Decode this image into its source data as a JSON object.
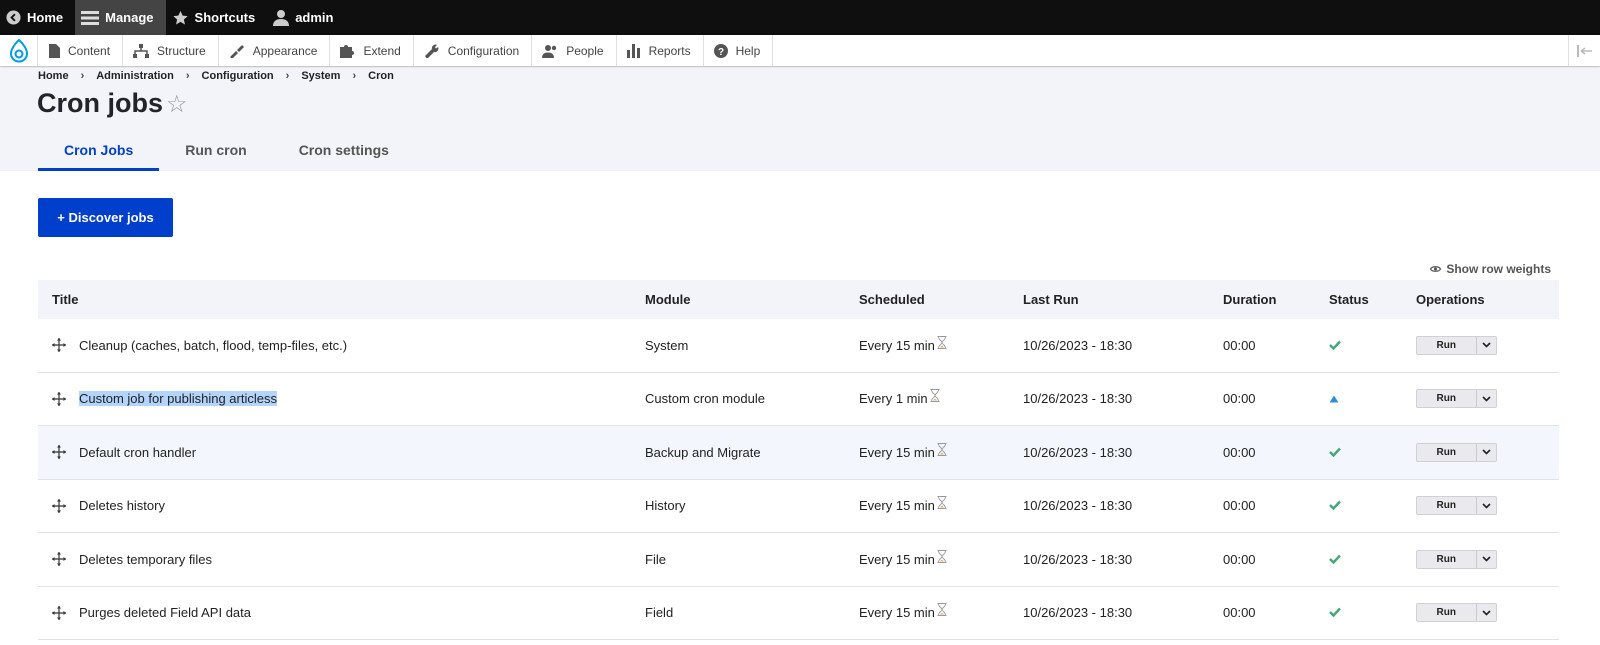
{
  "adminbar": {
    "home": "Home",
    "manage": "Manage",
    "shortcuts": "Shortcuts",
    "user": "admin"
  },
  "tray": {
    "items": [
      "Content",
      "Structure",
      "Appearance",
      "Extend",
      "Configuration",
      "People",
      "Reports",
      "Help"
    ]
  },
  "breadcrumb": [
    "Home",
    "Administration",
    "Configuration",
    "System",
    "Cron"
  ],
  "page_title": "Cron jobs",
  "tabs": [
    "Cron Jobs",
    "Run cron",
    "Cron settings"
  ],
  "discover_label": "+ Discover jobs",
  "row_weights_label": "Show row weights",
  "table": {
    "headers": [
      "Title",
      "Module",
      "Scheduled",
      "Last Run",
      "Duration",
      "Status",
      "Operations"
    ],
    "rows": [
      {
        "title": "Cleanup (caches, batch, flood, temp-files, etc.)",
        "module": "System",
        "scheduled": "Every 15 min",
        "last_run": "10/26/2023 - 18:30",
        "duration": "00:00",
        "status": "ok",
        "op": "Run"
      },
      {
        "title": "Custom job for publishing articless",
        "module": "Custom cron module",
        "scheduled": "Every 1 min",
        "last_run": "10/26/2023 - 18:30",
        "duration": "00:00",
        "status": "warning",
        "op": "Run"
      },
      {
        "title": "Default cron handler",
        "module": "Backup and Migrate",
        "scheduled": "Every 15 min",
        "last_run": "10/26/2023 - 18:30",
        "duration": "00:00",
        "status": "ok",
        "op": "Run"
      },
      {
        "title": "Deletes history",
        "module": "History",
        "scheduled": "Every 15 min",
        "last_run": "10/26/2023 - 18:30",
        "duration": "00:00",
        "status": "ok",
        "op": "Run"
      },
      {
        "title": "Deletes temporary files",
        "module": "File",
        "scheduled": "Every 15 min",
        "last_run": "10/26/2023 - 18:30",
        "duration": "00:00",
        "status": "ok",
        "op": "Run"
      },
      {
        "title": "Purges deleted Field API data",
        "module": "Field",
        "scheduled": "Every 15 min",
        "last_run": "10/26/2023 - 18:30",
        "duration": "00:00",
        "status": "ok",
        "op": "Run"
      }
    ]
  },
  "colors": {
    "accent": "#003ecc",
    "status_ok": "#42a877",
    "status_warning": "#2d8fd5"
  }
}
